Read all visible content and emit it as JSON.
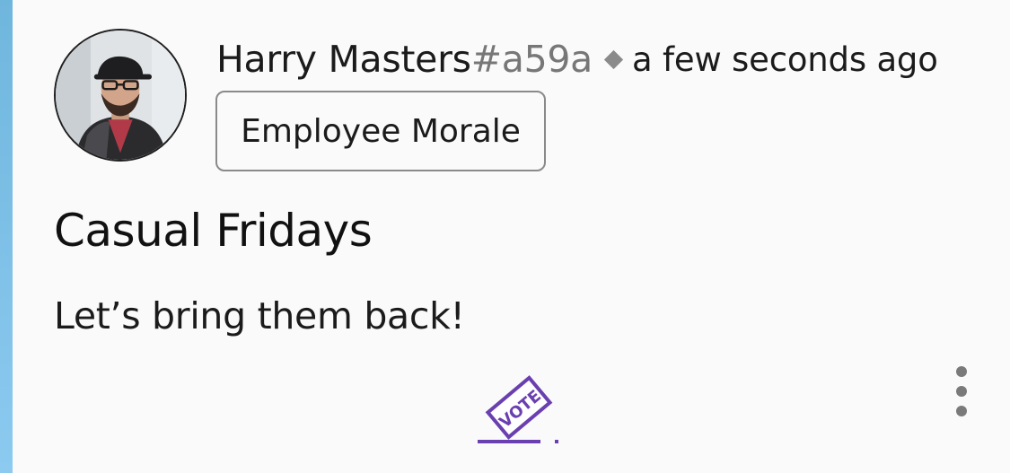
{
  "post": {
    "author_name": "Harry Masters",
    "author_hash": "#a59a",
    "timestamp": "a few seconds ago",
    "category_tag": "Employee Morale",
    "title": "Casual Fridays",
    "body": "Let’s bring them back!",
    "vote_label": "VOTE"
  },
  "icons": {
    "avatar": "user-avatar-photo",
    "separator": "diamond-icon",
    "vote": "ballot-box-vote-icon",
    "menu": "more-vertical-icon"
  },
  "colors": {
    "accent_bar": "#7cc0e8",
    "vote_purple": "#6a3fb0",
    "muted_text": "#777777"
  }
}
